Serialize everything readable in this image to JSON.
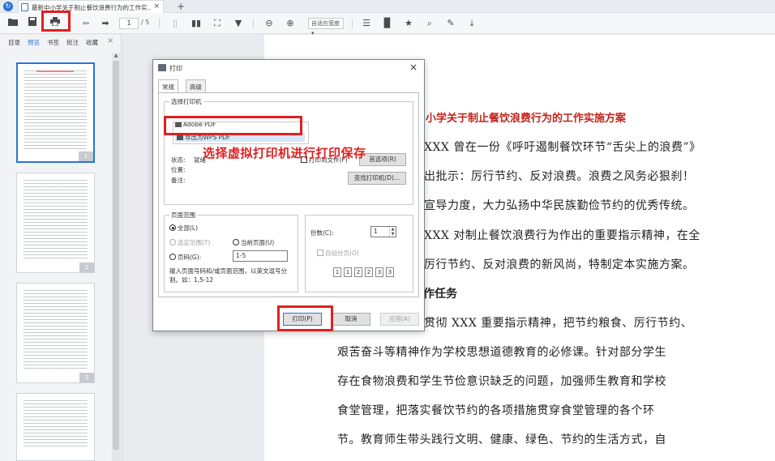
{
  "titlebar": {
    "tab_title": "最新中小学关于制止餐饮浪费行为的工作实...",
    "tab_close": "×",
    "new_tab": "+"
  },
  "toolbar": {
    "page_current": "1",
    "page_total": "/ 5",
    "zoom_label": "自适应宽度 ▾"
  },
  "sidebar": {
    "tabs": [
      "目录",
      "预览",
      "书签",
      "批注",
      "收藏"
    ],
    "active_tab": "预览",
    "close": "×",
    "pages": [
      "1",
      "2",
      "3"
    ]
  },
  "document": {
    "title": "小学关于制止餐饮浪费行为的工作实施方案",
    "lines": [
      "XXX 曾在一份《呼吁遏制餐饮环节“舌尖上的浪费”》",
      "出批示：厉行节约、反对浪费。浪费之风务必狠刹！",
      "宣导力度，大力弘扬中华民族勤俭节约的优秀传统。",
      "XXX 对制止餐饮浪费行为作出的重要指示精神，在全",
      "厉行节约、反对浪费的新风尚，特制定本实施方案。"
    ],
    "heading": "作任务",
    "body": [
      "贯彻 XXX 重要指示精神，把节约粮食、厉行节约、",
      "艰苦奋斗等精神作为学校思想道德教育的必修课。针对部分学生",
      "存在食物浪费和学生节俭意识缺乏的问题，加强师生教育和学校",
      "食堂管理，把落实餐饮节约的各项措施贯穿食堂管理的各个环",
      "节。教育师生带头践行文明、健康、绿色、节约的生活方式，自"
    ]
  },
  "dialog": {
    "title": "打印",
    "close": "×",
    "tabs": [
      "常规",
      "高级"
    ],
    "select_printer_label": "选择打印机",
    "printers": [
      "Adobe PDF",
      "导出为WPS PDF"
    ],
    "status_label": "状态:",
    "status_value": "就绪",
    "location_label": "位置:",
    "comment_label": "备注:",
    "print_to_file": "打印到文件(F)",
    "preferences_button": "首选项(R)",
    "find_printer_button": "查找打印机(D)...",
    "page_range_label": "页面范围",
    "range_all": "全部(L)",
    "range_selection": "选定范围(T)",
    "range_current": "当前页面(U)",
    "range_pages": "页码(G):",
    "pages_value": "1-5",
    "range_hint_1": "输入页面号码和/或页面范围，以英文逗号分",
    "range_hint_2": "割。如：1,5-12",
    "copies_label": "份数(C):",
    "copies_value": "1",
    "collate_label": "自动分页(O)",
    "collate_pages": [
      "1",
      "1",
      "2",
      "2",
      "3",
      "3"
    ],
    "print_button": "打印(P)",
    "cancel_button": "取消",
    "apply_button": "应用(A)"
  },
  "annotation": "选择虚拟打印机进行打印保存",
  "colors": {
    "highlight_red": "#e02020",
    "accent_blue": "#2a74d6",
    "title_red": "#c0241d"
  }
}
